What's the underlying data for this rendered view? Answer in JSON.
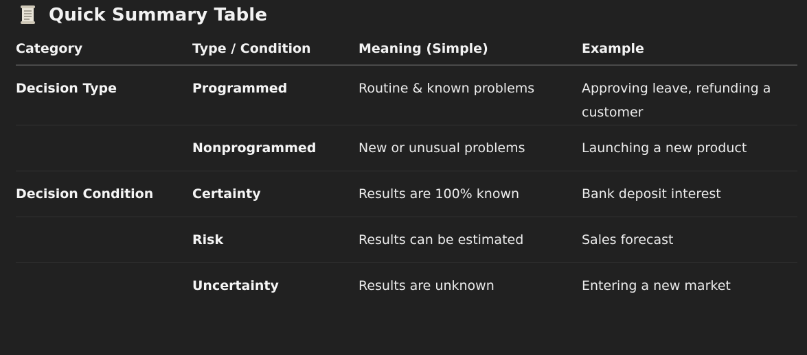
{
  "header": {
    "icon": "scroll-icon",
    "title": "Quick Summary Table"
  },
  "table": {
    "columns": [
      "Category",
      "Type / Condition",
      "Meaning (Simple)",
      "Example"
    ],
    "rows": [
      [
        "Decision Type",
        "Programmed",
        "Routine & known problems",
        "Approving leave, refunding a customer"
      ],
      [
        "",
        "Nonprogrammed",
        "New or unusual problems",
        "Launching a new product"
      ],
      [
        "Decision Condition",
        "Certainty",
        "Results are 100% known",
        "Bank deposit interest"
      ],
      [
        "",
        "Risk",
        "Results can be estimated",
        "Sales forecast"
      ],
      [
        "",
        "Uncertainty",
        "Results are unknown",
        "Entering a new market"
      ]
    ]
  },
  "colors": {
    "background": "#212121",
    "text": "#ececec",
    "divider": "#333333"
  }
}
